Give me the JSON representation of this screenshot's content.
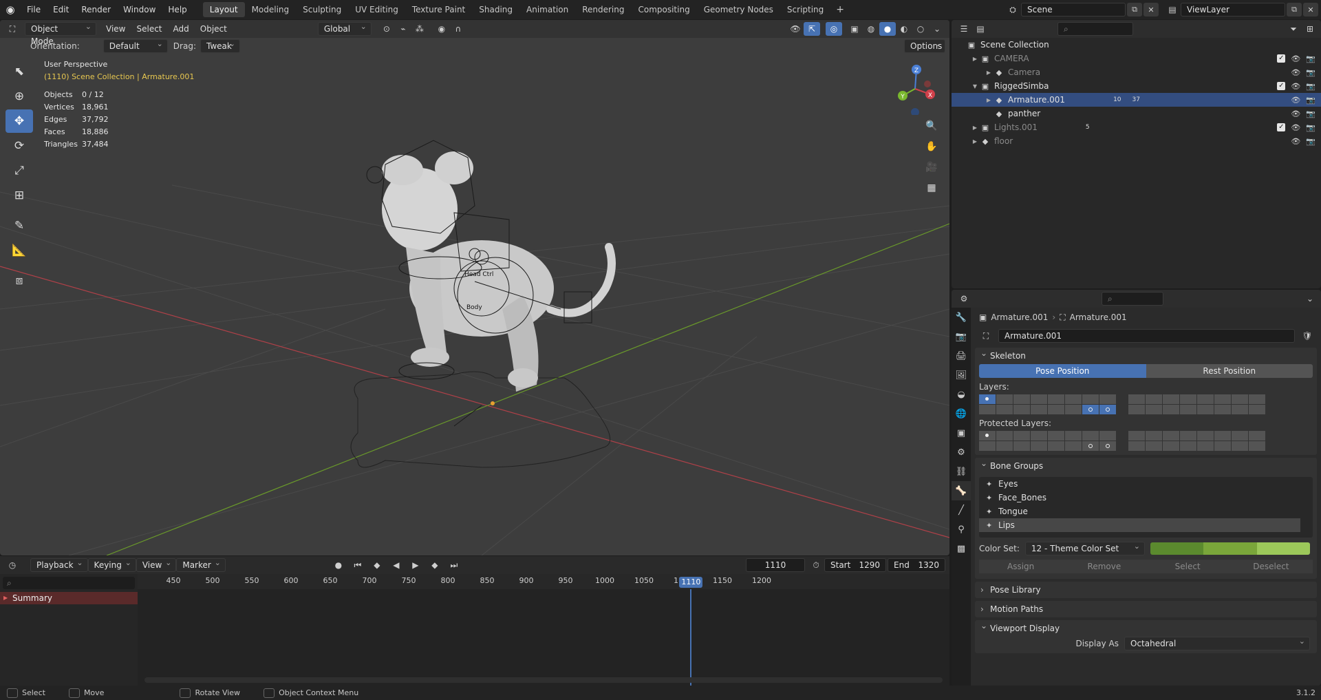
{
  "topbar": {
    "menus": [
      "File",
      "Edit",
      "Render",
      "Window",
      "Help"
    ],
    "workspaces": [
      "Layout",
      "Modeling",
      "Sculpting",
      "UV Editing",
      "Texture Paint",
      "Shading",
      "Animation",
      "Rendering",
      "Compositing",
      "Geometry Nodes",
      "Scripting"
    ],
    "active_workspace": "Layout",
    "scene": "Scene",
    "view_layer": "ViewLayer"
  },
  "viewport": {
    "mode": "Object Mode",
    "menus": [
      "View",
      "Select",
      "Add",
      "Object"
    ],
    "transform_orientation": "Global",
    "orientation_label": "Orientation:",
    "orientation_value": "Default",
    "drag_label": "Drag:",
    "drag_value": "Tweak",
    "options_label": "Options",
    "view_name": "User Perspective",
    "context": "(1110) Scene Collection | Armature.001",
    "stats": [
      {
        "label": "Objects",
        "value": "0 / 12"
      },
      {
        "label": "Vertices",
        "value": "18,961"
      },
      {
        "label": "Edges",
        "value": "37,792"
      },
      {
        "label": "Faces",
        "value": "18,886"
      },
      {
        "label": "Triangles",
        "value": "37,484"
      }
    ],
    "rig_labels": [
      "Head Ctrl",
      "Body"
    ],
    "axis_labels": {
      "y": "Y",
      "x": "X"
    }
  },
  "timeline": {
    "menus": [
      "Playback",
      "Keying",
      "View",
      "Marker"
    ],
    "current_frame": "1110",
    "start_label": "Start",
    "start": "1290",
    "end_label": "End",
    "end": "1320",
    "ticks": [
      "450",
      "500",
      "550",
      "600",
      "650",
      "700",
      "750",
      "800",
      "850",
      "900",
      "950",
      "1000",
      "1050",
      "1100",
      "1150",
      "1200"
    ],
    "playhead_frame": "1110",
    "summary": "Summary"
  },
  "statusbar": {
    "items": [
      "Select",
      "Move",
      "Rotate View",
      "Object Context Menu"
    ],
    "version": "3.1.2"
  },
  "outliner": {
    "root": "Scene Collection",
    "rows": [
      {
        "label": "CAMERA",
        "indent": 1,
        "dim": true,
        "check": true
      },
      {
        "label": "Camera",
        "indent": 2,
        "dim": true
      },
      {
        "label": "RiggedSimba",
        "indent": 1,
        "check": true
      },
      {
        "label": "Armature.001",
        "indent": 2,
        "selected": true,
        "badges": [
          "10",
          "37"
        ]
      },
      {
        "label": "panther",
        "indent": 2
      },
      {
        "label": "Lights.001",
        "indent": 1,
        "dim": true,
        "check": true,
        "badges": [
          "5"
        ]
      },
      {
        "label": "floor",
        "indent": 1,
        "dim": true
      }
    ]
  },
  "properties": {
    "breadcrumb_object": "Armature.001",
    "breadcrumb_data": "Armature.001",
    "data_name": "Armature.001",
    "skeleton": {
      "title": "Skeleton",
      "pose_position": "Pose Position",
      "rest_position": "Rest Position",
      "layers_label": "Layers:",
      "protected_label": "Protected Layers:"
    },
    "bone_groups": {
      "title": "Bone Groups",
      "items": [
        "Eyes",
        "Face_Bones",
        "Tongue",
        "Lips"
      ],
      "selected": "Lips",
      "color_set_label": "Color Set:",
      "color_set_value": "12 - Theme Color Set",
      "swatch_colors": [
        "#5b8a2e",
        "#7aa63a",
        "#9cc85a"
      ],
      "buttons": [
        "Assign",
        "Remove",
        "Select",
        "Deselect"
      ]
    },
    "collapsed_panels": [
      "Pose Library",
      "Motion Paths"
    ],
    "viewport_display": {
      "title": "Viewport Display",
      "display_as_label": "Display As",
      "display_as_value": "Octahedral"
    }
  }
}
